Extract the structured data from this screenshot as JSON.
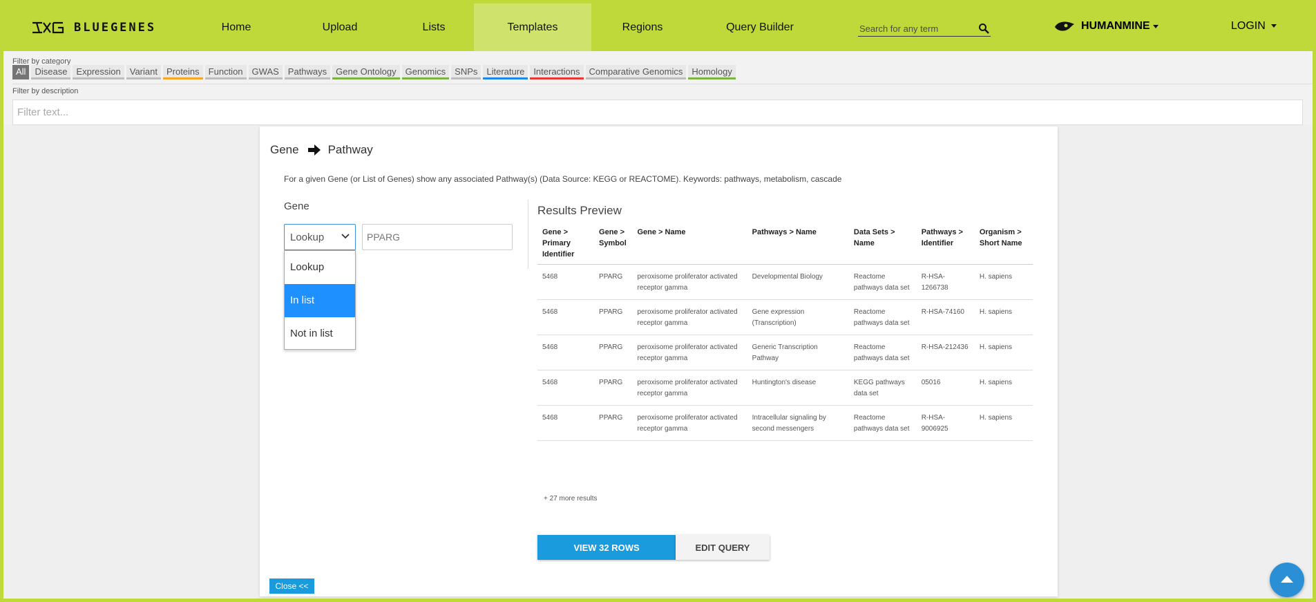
{
  "brand": {
    "name": "BLUEGENES"
  },
  "nav": {
    "items": [
      {
        "label": "Home"
      },
      {
        "label": "Upload"
      },
      {
        "label": "Lists"
      },
      {
        "label": "Templates"
      },
      {
        "label": "Regions"
      },
      {
        "label": "Query Builder"
      }
    ],
    "active": "Templates",
    "search_placeholder": "Search for any term",
    "mine_label": "HUMANMINE",
    "login_label": "LOGIN"
  },
  "filters": {
    "category_label": "Filter by category",
    "categories": [
      {
        "label": "All",
        "color": "#757575"
      },
      {
        "label": "Disease",
        "color": "#bdbdbd"
      },
      {
        "label": "Expression",
        "color": "#bdbdbd"
      },
      {
        "label": "Variant",
        "color": "#bdbdbd"
      },
      {
        "label": "Proteins",
        "color": "#f5a623"
      },
      {
        "label": "Function",
        "color": "#bdbdbd"
      },
      {
        "label": "GWAS",
        "color": "#bdbdbd"
      },
      {
        "label": "Pathways",
        "color": "#bdbdbd"
      },
      {
        "label": "Gene Ontology",
        "color": "#7cb342"
      },
      {
        "label": "Genomics",
        "color": "#7cb342"
      },
      {
        "label": "SNPs",
        "color": "#bdbdbd"
      },
      {
        "label": "Literature",
        "color": "#1e88e5"
      },
      {
        "label": "Interactions",
        "color": "#e53935"
      },
      {
        "label": "Comparative Genomics",
        "color": "#bdbdbd"
      },
      {
        "label": "Homology",
        "color": "#7cb342"
      }
    ],
    "description_label": "Filter by description",
    "description_placeholder": "Filter text..."
  },
  "template": {
    "from": "Gene",
    "to": "Pathway",
    "description": "For a given Gene (or List of Genes) show any associated Pathway(s) (Data Source: KEGG or REACTOME). Keywords: pathways, metabolism, cascade",
    "constraint_label": "Gene",
    "operator_selected": "Lookup",
    "operator_options": [
      "Lookup",
      "In list",
      "Not in list"
    ],
    "highlighted_option": "In list",
    "value": "PPARG"
  },
  "preview": {
    "title": "Results Preview",
    "columns": [
      "Gene > Primary Identifier",
      "Gene > Symbol",
      "Gene > Name",
      "Pathways > Name",
      "Data Sets > Name",
      "Pathways > Identifier",
      "Organism > Short Name"
    ],
    "rows": [
      [
        "5468",
        "PPARG",
        "peroxisome proliferator activated receptor gamma",
        "Developmental Biology",
        "Reactome pathways data set",
        "R-HSA-1266738",
        "H. sapiens"
      ],
      [
        "5468",
        "PPARG",
        "peroxisome proliferator activated receptor gamma",
        "Gene expression (Transcription)",
        "Reactome pathways data set",
        "R-HSA-74160",
        "H. sapiens"
      ],
      [
        "5468",
        "PPARG",
        "peroxisome proliferator activated receptor gamma",
        "Generic Transcription Pathway",
        "Reactome pathways data set",
        "R-HSA-212436",
        "H. sapiens"
      ],
      [
        "5468",
        "PPARG",
        "peroxisome proliferator activated receptor gamma",
        "Huntington's disease",
        "KEGG pathways data set",
        "05016",
        "H. sapiens"
      ],
      [
        "5468",
        "PPARG",
        "peroxisome proliferator activated receptor gamma",
        "Intracellular signaling by second messengers",
        "Reactome pathways data set",
        "R-HSA-9006925",
        "H. sapiens"
      ]
    ],
    "more_results": "+ 27 more results"
  },
  "actions": {
    "view_label": "VIEW 32 ROWS",
    "edit_label": "EDIT QUERY",
    "close_label": "Close <<"
  },
  "colors": {
    "navbar": "#bfd93a",
    "active_tab": "#cfe36c",
    "primary": "#1a9bdd",
    "highlight": "#1e90ff"
  }
}
